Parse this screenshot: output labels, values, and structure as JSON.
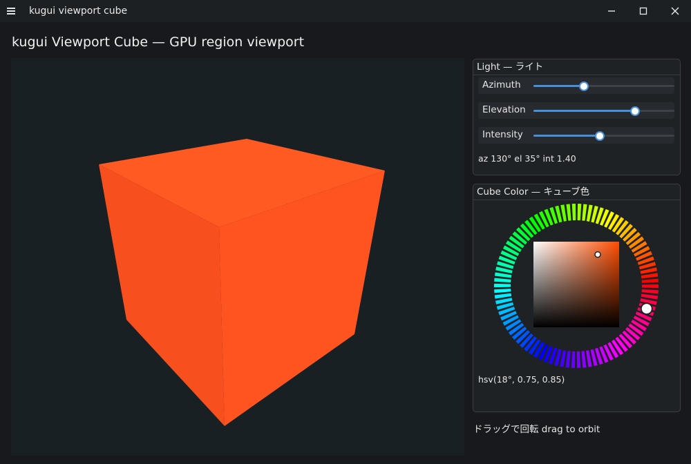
{
  "window": {
    "title": "kugui viewport cube",
    "menu_icon": "hamburger-menu-icon",
    "controls": [
      "minimize-icon",
      "maximize-icon",
      "close-icon"
    ]
  },
  "page": {
    "title": "kugui Viewport Cube — GPU region viewport"
  },
  "viewport": {
    "background": "#182024",
    "cube_color": "#ff5420"
  },
  "light_panel": {
    "title": "Light — ライト",
    "sliders": [
      {
        "label": "Azimuth",
        "fraction": 0.36
      },
      {
        "label": "Elevation",
        "fraction": 0.72
      },
      {
        "label": "Intensity",
        "fraction": 0.47
      }
    ],
    "readout": "az 130°  el 35°  int 1.40",
    "accent": "#4a90d9"
  },
  "color_panel": {
    "title": "Cube Color — キューブ色",
    "hue": 18,
    "saturation": 0.75,
    "value": 0.85,
    "readout": "hsv(18°, 0.75, 0.85)"
  },
  "hint": "ドラッグで回転 drag to orbit"
}
